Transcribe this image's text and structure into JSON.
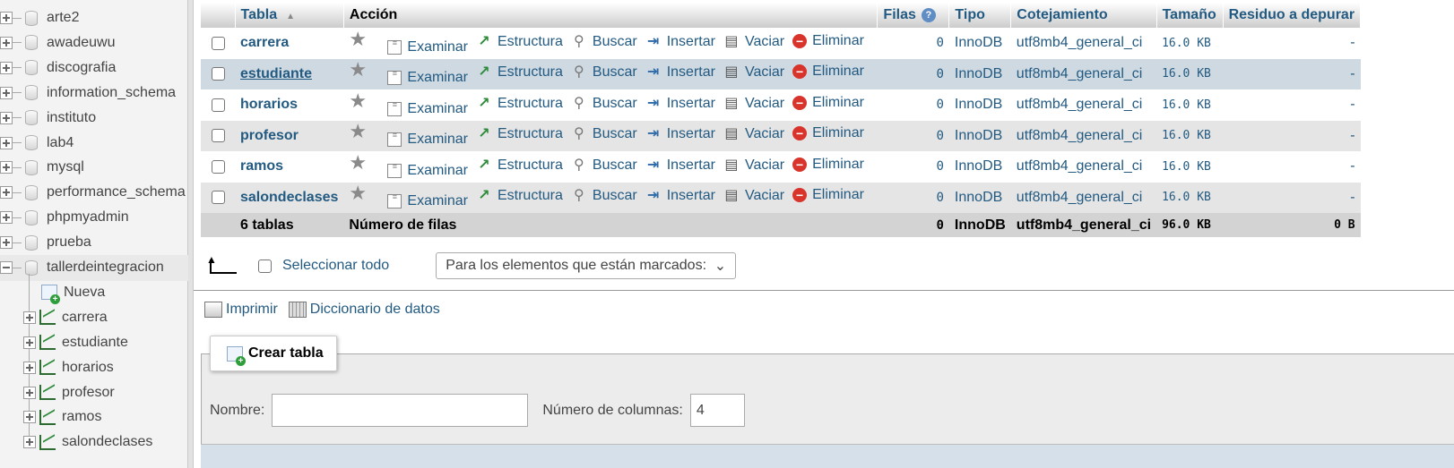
{
  "sidebar": {
    "databases": [
      {
        "name": "arte2"
      },
      {
        "name": "awadeuwu"
      },
      {
        "name": "discografia"
      },
      {
        "name": "information_schema"
      },
      {
        "name": "instituto"
      },
      {
        "name": "lab4"
      },
      {
        "name": "mysql"
      },
      {
        "name": "performance_schema"
      },
      {
        "name": "phpmyadmin"
      },
      {
        "name": "prueba"
      },
      {
        "name": "tallerdeintegracion"
      }
    ],
    "active_db_children": {
      "new_label": "Nueva",
      "tables": [
        "carrera",
        "estudiante",
        "horarios",
        "profesor",
        "ramos",
        "salondeclases"
      ]
    }
  },
  "table_list": {
    "headers": {
      "table": "Tabla",
      "action": "Acción",
      "rows": "Filas",
      "type": "Tipo",
      "collation": "Cotejamiento",
      "size": "Tamaño",
      "overhead": "Residuo a depurar"
    },
    "actions": {
      "browse": "Examinar",
      "structure": "Estructura",
      "search": "Buscar",
      "insert": "Insertar",
      "empty": "Vaciar",
      "drop": "Eliminar"
    },
    "rows": [
      {
        "name": "carrera",
        "rows": "0",
        "type": "InnoDB",
        "collation": "utf8mb4_general_ci",
        "size": "16.0 KB",
        "overhead": "-"
      },
      {
        "name": "estudiante",
        "rows": "0",
        "type": "InnoDB",
        "collation": "utf8mb4_general_ci",
        "size": "16.0 KB",
        "overhead": "-"
      },
      {
        "name": "horarios",
        "rows": "0",
        "type": "InnoDB",
        "collation": "utf8mb4_general_ci",
        "size": "16.0 KB",
        "overhead": "-"
      },
      {
        "name": "profesor",
        "rows": "0",
        "type": "InnoDB",
        "collation": "utf8mb4_general_ci",
        "size": "16.0 KB",
        "overhead": "-"
      },
      {
        "name": "ramos",
        "rows": "0",
        "type": "InnoDB",
        "collation": "utf8mb4_general_ci",
        "size": "16.0 KB",
        "overhead": "-"
      },
      {
        "name": "salondeclases",
        "rows": "0",
        "type": "InnoDB",
        "collation": "utf8mb4_general_ci",
        "size": "16.0 KB",
        "overhead": "-"
      }
    ],
    "footer": {
      "count": "6 tablas",
      "label": "Número de filas",
      "rows": "0",
      "type": "InnoDB",
      "collation": "utf8mb4_general_ci",
      "size": "96.0 KB",
      "overhead": "0 B"
    }
  },
  "bulk": {
    "select_all": "Seleccionar todo",
    "with_selected": "Para los elementos que están marcados:"
  },
  "links": {
    "print": "Imprimir",
    "data_dictionary": "Diccionario de datos"
  },
  "create_table": {
    "legend": "Crear tabla",
    "name_label": "Nombre:",
    "name_value": "",
    "columns_label": "Número de columnas:",
    "columns_value": "4"
  }
}
